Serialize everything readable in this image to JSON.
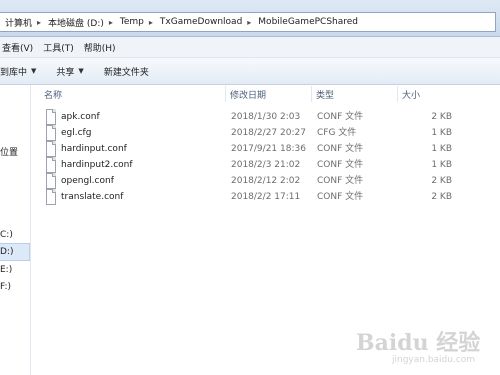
{
  "breadcrumb": [
    "计算机",
    "本地磁盘 (D:)",
    "Temp",
    "TxGameDownload",
    "MobileGamePCShared"
  ],
  "menu": [
    "查看(V)",
    "工具(T)",
    "帮助(H)"
  ],
  "toolbar": {
    "include_label": "到库中",
    "share_label": "共享",
    "new_folder_label": "新建文件夹"
  },
  "sidebar": {
    "items": [
      "位置",
      "C:)",
      "D:)",
      "E:)",
      "F:)"
    ],
    "selected": "D:)"
  },
  "columns": {
    "name": "名称",
    "date": "修改日期",
    "type": "类型",
    "size": "大小"
  },
  "files": [
    {
      "name": "apk.conf",
      "date": "2018/1/30 2:03",
      "type": "CONF 文件",
      "size": "2 KB"
    },
    {
      "name": "egl.cfg",
      "date": "2018/2/27 20:27",
      "type": "CFG 文件",
      "size": "1 KB"
    },
    {
      "name": "hardinput.conf",
      "date": "2017/9/21 18:36",
      "type": "CONF 文件",
      "size": "1 KB"
    },
    {
      "name": "hardinput2.conf",
      "date": "2018/2/3 21:02",
      "type": "CONF 文件",
      "size": "1 KB"
    },
    {
      "name": "opengl.conf",
      "date": "2018/2/12 2:02",
      "type": "CONF 文件",
      "size": "2 KB"
    },
    {
      "name": "translate.conf",
      "date": "2018/2/2 17:11",
      "type": "CONF 文件",
      "size": "2 KB"
    }
  ],
  "watermark": {
    "logo": "Baidu 经验",
    "url": "jingyan.baidu.com"
  }
}
